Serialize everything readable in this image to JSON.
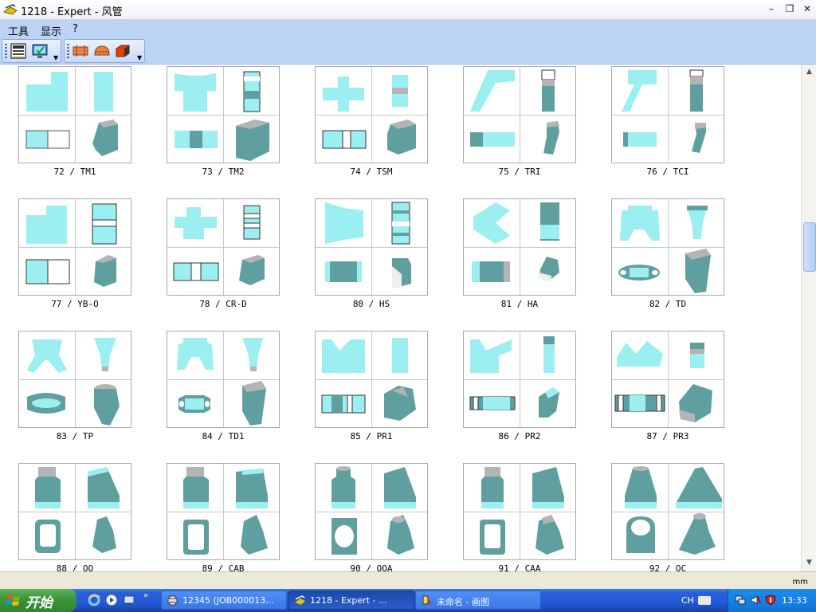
{
  "window": {
    "title": "1218 - Expert - 风管"
  },
  "menu": {
    "items": [
      "工具",
      "显示",
      "?"
    ]
  },
  "colors": {
    "accent": "#9beff0",
    "dark": "#5f9fa0",
    "grey": "#b4b4b4",
    "titlebar": "#eef1f7",
    "menubar": "#bcd3f5",
    "taskbar": "#245ad8",
    "start": "#3c963c"
  },
  "grid": {
    "cells": [
      {
        "caption": "72 / TM1"
      },
      {
        "caption": "73 / TM2"
      },
      {
        "caption": "74 / TSM"
      },
      {
        "caption": "75 / TRI"
      },
      {
        "caption": "76 / TCI"
      },
      {
        "caption": "77 / YB-O"
      },
      {
        "caption": "78 / CR-D"
      },
      {
        "caption": "80 / HS"
      },
      {
        "caption": "81 / HA"
      },
      {
        "caption": "82 / TD"
      },
      {
        "caption": "83 / TP"
      },
      {
        "caption": "84 / TD1"
      },
      {
        "caption": "85 / PR1"
      },
      {
        "caption": "86 / PR2"
      },
      {
        "caption": "87 / PR3"
      },
      {
        "caption": "88 / OO"
      },
      {
        "caption": "89 / CAB"
      },
      {
        "caption": "90 / OOA"
      },
      {
        "caption": "91 / CAA"
      },
      {
        "caption": "92 / OC"
      }
    ]
  },
  "statusbar": {
    "unit": "mm"
  },
  "taskbar": {
    "start_label": "开始",
    "buttons": [
      {
        "label": "12345 (JOB000013..."
      },
      {
        "label": "1218 - Expert - ..."
      },
      {
        "label": "未命名 - 画图"
      }
    ],
    "lang": "CH",
    "clock": "13:33"
  },
  "icons": {
    "app": "duct-app-icon",
    "minimize": "minimize-icon",
    "restore": "restore-icon",
    "close": "close-icon",
    "toolbar": [
      "calculator-icon",
      "monitor-icon",
      "duct-orange-icon",
      "duct-elbow-icon",
      "duct-box-icon"
    ],
    "scroll_up": "scroll-up-arrow-icon",
    "scroll_down": "scroll-down-arrow-icon",
    "start_logo": "windows-logo-icon",
    "ie": "ie-icon",
    "media": "media-player-icon",
    "desktop": "show-desktop-icon",
    "tray": [
      "network-icon",
      "volume-icon",
      "shield-icon"
    ]
  }
}
